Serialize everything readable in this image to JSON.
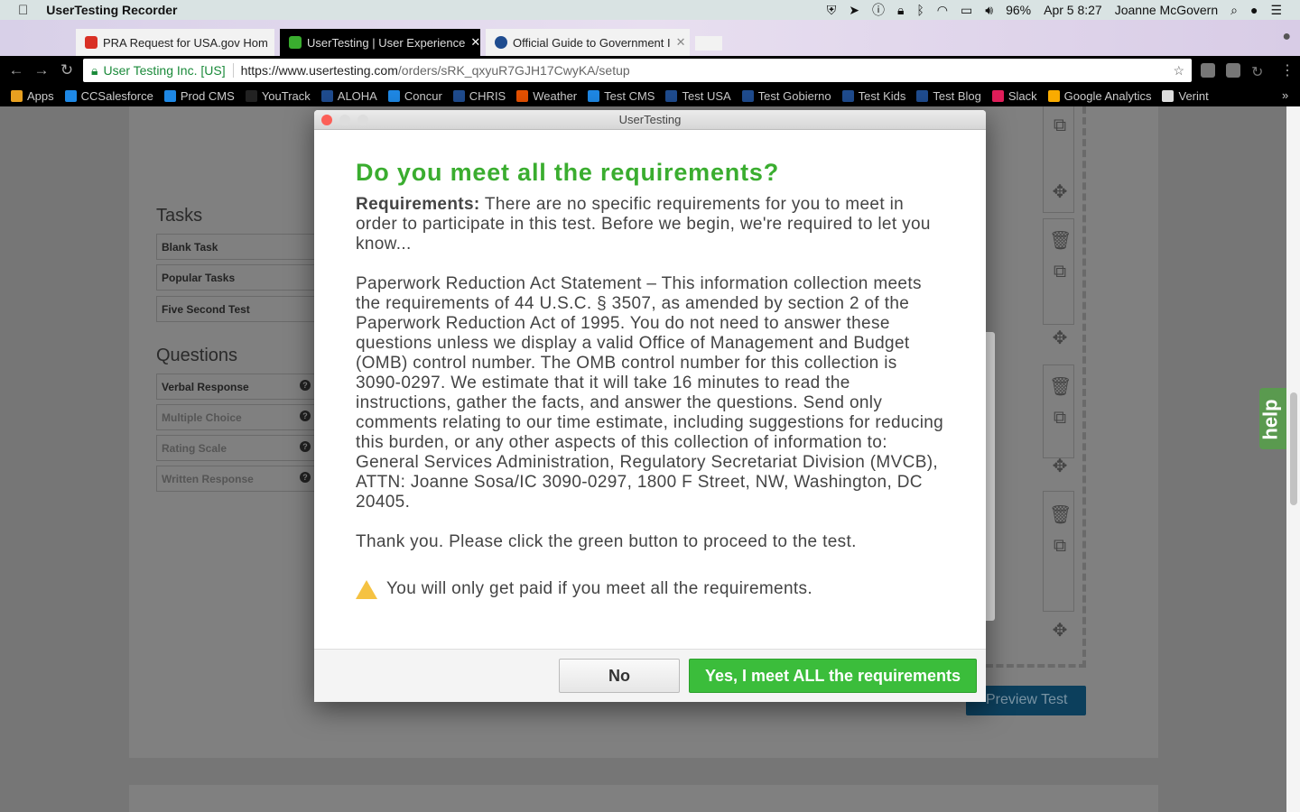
{
  "menubar": {
    "app": "UserTesting Recorder",
    "battery": "96%",
    "datetime": "Apr 5  8:27",
    "user": "Joanne McGovern"
  },
  "tabs": [
    {
      "title": "PRA Request for USA.gov Hom",
      "color": "#d93025"
    },
    {
      "title": "UserTesting | User Experience",
      "color": "#3aad2f"
    },
    {
      "title": "Official Guide to Government I",
      "color": "#1f4c8f"
    }
  ],
  "address": {
    "org": "User Testing Inc. [US]",
    "url_host": "https://www.usertesting.com",
    "url_path": "/orders/sRK_qxyuR7GJH17CwyKA/setup"
  },
  "bookmarks": [
    {
      "label": "Apps",
      "color": "#e8a020"
    },
    {
      "label": "CCSalesforce",
      "color": "#1e88e5"
    },
    {
      "label": "Prod CMS",
      "color": "#1e88e5"
    },
    {
      "label": "YouTrack",
      "color": "#222"
    },
    {
      "label": "ALOHA",
      "color": "#1f4c8f"
    },
    {
      "label": "Concur",
      "color": "#1e88e5"
    },
    {
      "label": "CHRIS",
      "color": "#1f4c8f"
    },
    {
      "label": "Weather",
      "color": "#e65100"
    },
    {
      "label": "Test CMS",
      "color": "#1e88e5"
    },
    {
      "label": "Test USA",
      "color": "#1f4c8f"
    },
    {
      "label": "Test Gobierno",
      "color": "#1f4c8f"
    },
    {
      "label": "Test Kids",
      "color": "#1f4c8f"
    },
    {
      "label": "Test Blog",
      "color": "#1f4c8f"
    },
    {
      "label": "Slack",
      "color": "#e01e5a"
    },
    {
      "label": "Google Analytics",
      "color": "#f9ab00"
    },
    {
      "label": "Verint",
      "color": "#ddd"
    }
  ],
  "sidebar": {
    "tasks_heading": "Tasks",
    "tasks": [
      "Blank Task",
      "Popular Tasks",
      "Five Second Test"
    ],
    "questions_heading": "Questions",
    "questions": [
      "Verbal Response",
      "Multiple Choice",
      "Rating Scale",
      "Written Response"
    ]
  },
  "page": {
    "preview_button": "Preview Test",
    "help_tab": "help"
  },
  "modal": {
    "window_title": "UserTesting",
    "heading": "Do you meet all the requirements?",
    "requirements_label": "Requirements:",
    "requirements_text": " There are no specific requirements for you to meet in order to participate in this test. Before we begin, we're required to let you know...",
    "pra_text": "Paperwork Reduction Act Statement – This information collection meets the requirements of 44 U.S.C. § 3507, as amended by section 2 of the Paperwork Reduction Act of 1995. You do not need to answer these questions unless we display a valid Office of Management and Budget (OMB) control number. The OMB control number for this collection is 3090-0297. We estimate that it will take 16 minutes to read the instructions, gather the facts, and answer the questions. Send only comments relating to our time estimate, including suggestions for reducing this burden, or any other aspects of this collection of information to: General Services Administration, Regulatory Secretariat Division (MVCB), ATTN: Joanne Sosa/IC 3090-0297, 1800 F Street, NW, Washington, DC 20405.",
    "thanks_text": "Thank you. Please click the green button to proceed to the test.",
    "warning_text": "You will only get paid if you meet all the requirements.",
    "no_button": "No",
    "yes_button": "Yes, I meet ALL the requirements"
  }
}
